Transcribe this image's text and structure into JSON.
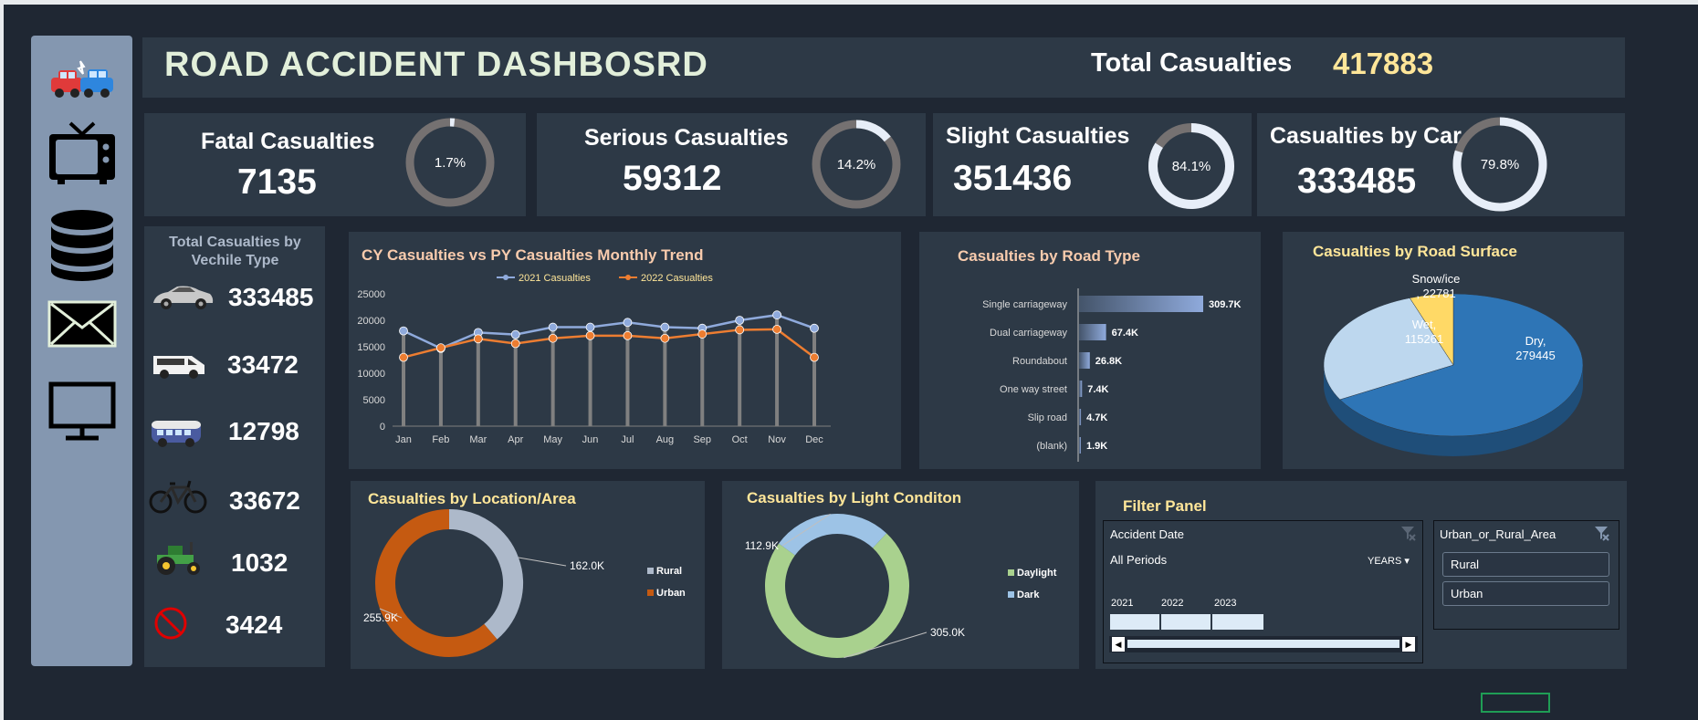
{
  "dashboard": {
    "title": "ROAD ACCIDENT DASHBOSRD",
    "total_label": "Total Casualties",
    "total_value": "417883"
  },
  "kpis": [
    {
      "label": "Fatal Casualties",
      "value": "7135",
      "pct": 1.7,
      "pct_label": "1.7%"
    },
    {
      "label": "Serious Casualties",
      "value": "59312",
      "pct": 14.2,
      "pct_label": "14.2%"
    },
    {
      "label": "Slight Casualties",
      "value": "351436",
      "pct": 84.1,
      "pct_label": "84.1%"
    },
    {
      "label": "Casualties by Car",
      "value": "333485",
      "pct": 79.8,
      "pct_label": "79.8%"
    }
  ],
  "sidebar": {
    "icons": [
      "car-crash-icon",
      "tv-icon",
      "database-icon",
      "mail-icon",
      "monitor-icon"
    ]
  },
  "vehicles": {
    "title_line1": "Total Casualties by",
    "title_line2": "Vechile Type",
    "items": [
      {
        "icon": "car-icon",
        "value": "333485",
        "color": "#7f7f7f"
      },
      {
        "icon": "van-icon",
        "value": "33472",
        "color": "#d9d9d9"
      },
      {
        "icon": "bus-icon",
        "value": "12798",
        "color": "#8497b0"
      },
      {
        "icon": "bicycle-icon",
        "value": "33672",
        "color": "#ffe699"
      },
      {
        "icon": "tractor-icon",
        "value": "1032",
        "color": "#e2efda"
      },
      {
        "icon": "no-symbol-icon",
        "value": "3424",
        "color": "#ff0000"
      }
    ]
  },
  "chart_data": [
    {
      "type": "line",
      "title": "CY Casualties vs PY Casualties Monthly Trend",
      "categories": [
        "Jan",
        "Feb",
        "Mar",
        "Apr",
        "May",
        "Jun",
        "Jul",
        "Aug",
        "Sep",
        "Oct",
        "Nov",
        "Dec"
      ],
      "series": [
        {
          "name": "2021 Casualties",
          "color": "#8faadc",
          "values": [
            18000,
            14700,
            17700,
            17300,
            18700,
            18700,
            19600,
            18700,
            18500,
            20000,
            21000,
            18500
          ]
        },
        {
          "name": "2022 Casualties",
          "color": "#ed7d31",
          "values": [
            13000,
            14800,
            16500,
            15600,
            16600,
            17100,
            17100,
            16600,
            17400,
            18200,
            18300,
            13000
          ]
        }
      ],
      "y_ticks": [
        "0",
        "5000",
        "10000",
        "15000",
        "20000",
        "25000"
      ],
      "ylim": [
        0,
        25000
      ],
      "legend": "top"
    },
    {
      "type": "bar",
      "title": "Casualties by Road Type",
      "categories": [
        "Single carriageway",
        "Dual carriageway",
        "Roundabout",
        "One way street",
        "Slip road",
        "(blank)"
      ],
      "values": [
        309700,
        67400,
        26800,
        7400,
        4700,
        1900
      ],
      "value_labels": [
        "309.7K",
        "67.4K",
        "26.8K",
        "7.4K",
        "4.7K",
        "1.9K"
      ]
    },
    {
      "type": "pie",
      "title": "Casualties by Road Surface",
      "slices": [
        {
          "name": "Dry,",
          "value": 279445,
          "label": "279445",
          "color": "#2e75b6"
        },
        {
          "name": "Wet,",
          "value": 115261,
          "label": "115261",
          "color": "#bdd7ee"
        },
        {
          "name": "Snow/ice",
          "value": 22781,
          "label": ", 22781",
          "color": "#ffd966"
        }
      ]
    },
    {
      "type": "pie",
      "title": "Casualties by Location/Area",
      "slices": [
        {
          "name": "Rural",
          "value": 162000,
          "label": "162.0K",
          "color": "#adb9ca"
        },
        {
          "name": "Urban",
          "value": 255900,
          "label": "255.9K",
          "color": "#c55a11"
        }
      ],
      "legend": "right"
    },
    {
      "type": "pie",
      "title": "Casualties by Light Conditon",
      "slices": [
        {
          "name": "Daylight",
          "value": 305000,
          "label": "305.0K",
          "color": "#a9d18e"
        },
        {
          "name": "Dark",
          "value": 112900,
          "label": "112.9K",
          "color": "#9dc3e6"
        }
      ],
      "legend": "right"
    }
  ],
  "filter": {
    "title": "Filter Panel",
    "date_slicer": {
      "header": "Accident Date",
      "period": "All Periods",
      "unit": "YEARS",
      "years": [
        "2021",
        "2022",
        "2023"
      ]
    },
    "area_slicer": {
      "header": "Urban_or_Rural_Area",
      "options": [
        "Rural",
        "Urban"
      ]
    }
  }
}
